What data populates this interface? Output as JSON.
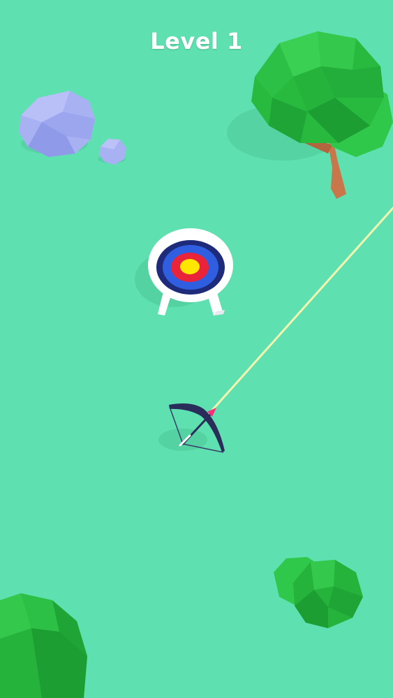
{
  "hud": {
    "level_text": "Level 1"
  },
  "colors": {
    "ground": "#5fe0b0",
    "tree_dark": "#22b73a",
    "tree_light": "#3fd354",
    "trunk": "#c9764a",
    "rock": "#a6b0f0",
    "rock_shade": "#8c98e6",
    "target_outer": "#ffffff",
    "target_ring_dark": "#1d2b7a",
    "target_ring_blue": "#2f5fe0",
    "target_ring_red": "#e9243a",
    "target_center": "#ffe600",
    "bow": "#2a2d59",
    "arrow_tip": "#ff2d7a",
    "aim_line": "#f3f7b0"
  },
  "objects": {
    "target": "archery-target",
    "bow": "bow",
    "aim": "aim-trajectory-line"
  }
}
